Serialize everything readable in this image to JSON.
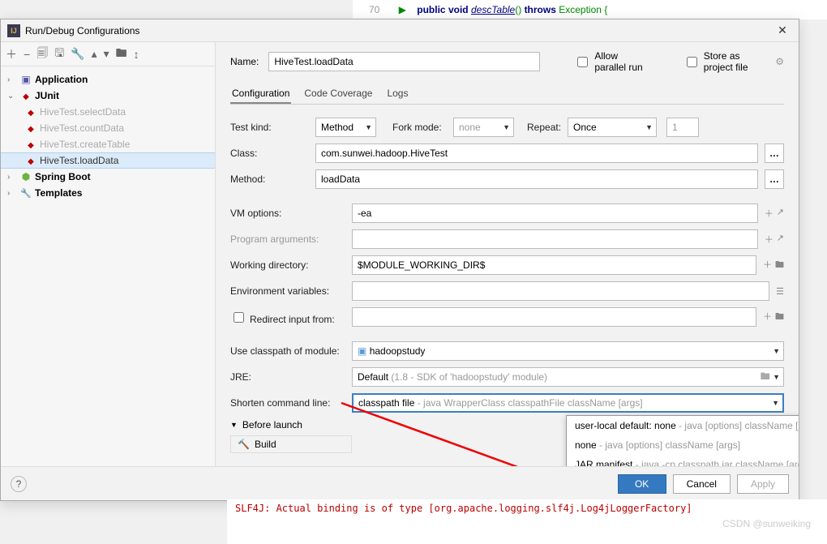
{
  "code_top": {
    "line_no": "70",
    "src": "public void descTable() throws Exception {"
  },
  "dialog": {
    "title": "Run/Debug Configurations",
    "toolbar_icons": [
      "add",
      "remove",
      "copy",
      "save",
      "wrench",
      "up",
      "down",
      "folder",
      "sort"
    ],
    "tree": {
      "nodes": [
        {
          "label": "Application",
          "icon": "app",
          "expanded": true,
          "children": []
        },
        {
          "label": "JUnit",
          "icon": "junit",
          "expanded": true,
          "children": [
            {
              "label": "HiveTest.selectData"
            },
            {
              "label": "HiveTest.countData"
            },
            {
              "label": "HiveTest.createTable"
            },
            {
              "label": "HiveTest.loadData",
              "selected": true
            }
          ]
        },
        {
          "label": "Spring Boot",
          "icon": "spring",
          "expanded": false,
          "children": []
        },
        {
          "label": "Templates",
          "icon": "tmpl",
          "expanded": false,
          "children": []
        }
      ]
    },
    "name_row": {
      "label": "Name:",
      "value": "HiveTest.loadData",
      "parallel_label": "Allow parallel run",
      "store_label": "Store as project file"
    },
    "tabs": {
      "items": [
        "Configuration",
        "Code Coverage",
        "Logs"
      ],
      "active": 0
    },
    "form": {
      "test_kind": {
        "label": "Test kind:",
        "value": "Method"
      },
      "fork_mode": {
        "label": "Fork mode:",
        "value": "none"
      },
      "repeat": {
        "label": "Repeat:",
        "value": "Once",
        "count": "1"
      },
      "class": {
        "label": "Class:",
        "value": "com.sunwei.hadoop.HiveTest"
      },
      "method": {
        "label": "Method:",
        "value": "loadData"
      },
      "vm_options": {
        "label": "VM options:",
        "value": "-ea"
      },
      "prog_args": {
        "label": "Program arguments:",
        "value": ""
      },
      "work_dir": {
        "label": "Working directory:",
        "value": "$MODULE_WORKING_DIR$"
      },
      "env_vars": {
        "label": "Environment variables:",
        "value": ""
      },
      "redirect": {
        "label": "Redirect input from:",
        "value": ""
      },
      "classpath": {
        "label": "Use classpath of module:",
        "value": "hadoopstudy"
      },
      "jre": {
        "label": "JRE:",
        "value_main": "Default",
        "value_sub": " (1.8 - SDK of 'hadoopstudy' module)"
      },
      "shorten": {
        "label": "Shorten command line:",
        "value_main": "classpath file",
        "value_sub": " - java WrapperClass classpathFile className [args]",
        "options": [
          {
            "main": "user-local default: none",
            "sub": " - java [options] className [args]"
          },
          {
            "main": "none",
            "sub": " - java [options] className [args]"
          },
          {
            "main": "JAR manifest",
            "sub": " - java -cp classpath.jar className [args]"
          },
          {
            "main": "classpath file",
            "sub": " - java WrapperClass classpathFile className [args]",
            "selected": true
          }
        ]
      }
    },
    "before_launch": {
      "header": "Before launch",
      "item": "Build"
    },
    "footer": {
      "ok": "OK",
      "cancel": "Cancel",
      "apply": "Apply"
    }
  },
  "code_bottom": "SLF4J: Actual binding is of type [org.apache.logging.slf4j.Log4jLoggerFactory]",
  "watermark": "CSDN @sunweiking"
}
